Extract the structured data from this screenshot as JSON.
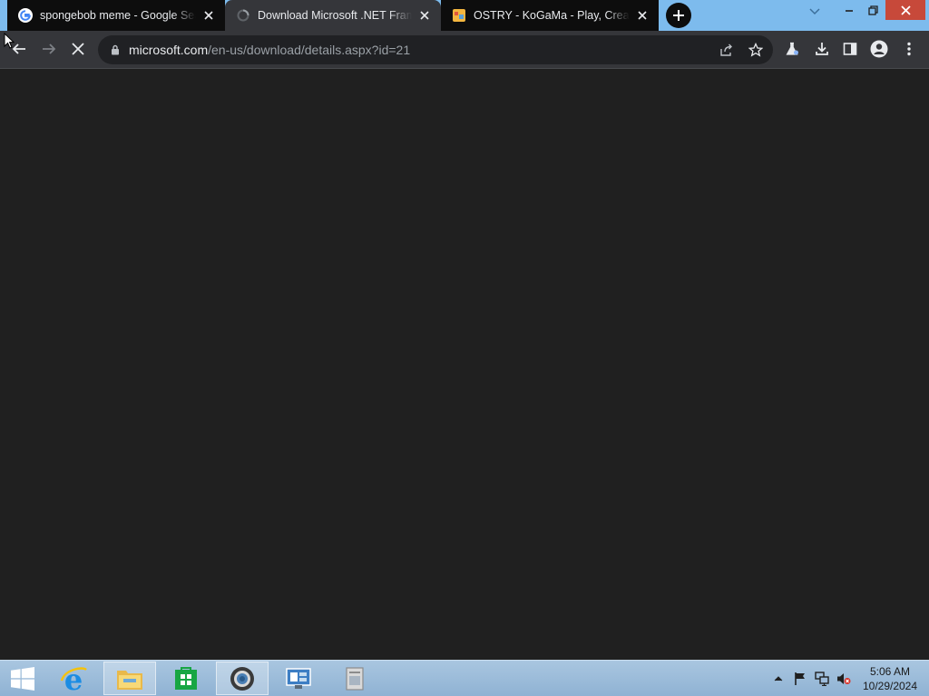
{
  "tabs": [
    {
      "title": "spongebob meme - Google Search",
      "favicon": "google-g-icon"
    },
    {
      "title": "Download Microsoft .NET Framework",
      "favicon": "loading-spinner-icon"
    },
    {
      "title": "OSTRY - KoGaMa - Play, Create And Share",
      "favicon": "kogama-icon"
    }
  ],
  "omnibox": {
    "host": "microsoft.com",
    "path": "/en-us/download/details.aspx?id=21"
  },
  "taskbar": {
    "clock_time": "5:06 AM",
    "clock_date": "10/29/2024"
  },
  "colors": {
    "titlebar": "#7dbbed",
    "toolbar": "#35363a",
    "content": "#202020",
    "taskbar": "#9dbcdb"
  }
}
